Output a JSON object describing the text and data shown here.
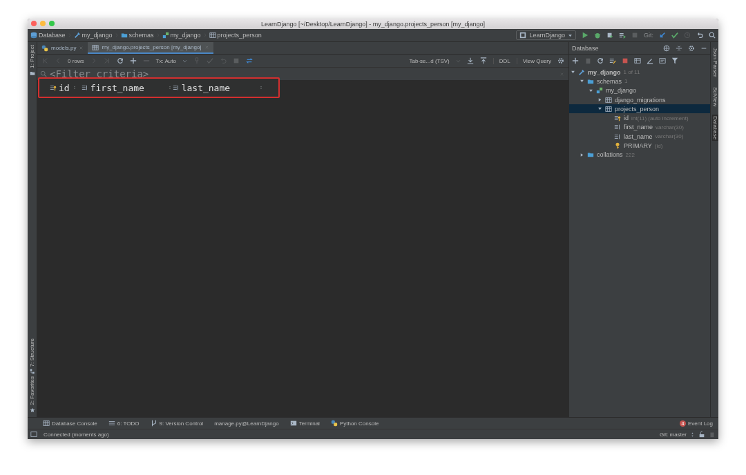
{
  "window": {
    "title": "LearnDjango [~/Desktop/LearnDjango] - my_django.projects_person [my_django]"
  },
  "breadcrumbs": [
    {
      "label": "Database",
      "kind": "database"
    },
    {
      "label": "my_django",
      "kind": "connection"
    },
    {
      "label": "schemas",
      "kind": "folder"
    },
    {
      "label": "my_django",
      "kind": "schema"
    },
    {
      "label": "projects_person",
      "kind": "table"
    }
  ],
  "run_config": {
    "label": "LearnDjango"
  },
  "git_toolbar": {
    "label": "Git:"
  },
  "left_strip": {
    "top": [
      {
        "label": "1: Project"
      }
    ],
    "bottom": [
      {
        "label": "7: Structure"
      },
      {
        "label": "2: Favorites"
      }
    ]
  },
  "editor_tabs": [
    {
      "label": "models.py",
      "kind": "python",
      "selected": false
    },
    {
      "label": "my_django.projects_person [my_django]",
      "kind": "table",
      "selected": true
    }
  ],
  "grid_toolbar": {
    "rows": "0 rows",
    "transaction": "Tx: Auto",
    "format": "Tab-se...d (TSV)",
    "buttons": [
      "DDL",
      "View Query"
    ]
  },
  "filter": {
    "placeholder": "<Filter criteria>"
  },
  "columns": [
    {
      "name": "id",
      "kind": "key"
    },
    {
      "name": "first_name",
      "kind": "column"
    },
    {
      "name": "last_name",
      "kind": "column"
    }
  ],
  "database_panel": {
    "title": "Database",
    "tree": [
      {
        "name": "my_django",
        "detail": "1 of 11",
        "kind": "connection",
        "expanded": true,
        "selected": false,
        "children": [
          {
            "name": "schemas",
            "detail": "1",
            "kind": "folder",
            "expanded": true,
            "selected": false,
            "children": [
              {
                "name": "my_django",
                "kind": "schema",
                "expanded": true,
                "selected": false,
                "children": [
                  {
                    "name": "django_migrations",
                    "kind": "table",
                    "expanded": false,
                    "selected": false
                  },
                  {
                    "name": "projects_person",
                    "kind": "table",
                    "expanded": true,
                    "selected": true,
                    "children": [
                      {
                        "name": "id",
                        "detail": "int(11) (auto increment)",
                        "kind": "key"
                      },
                      {
                        "name": "first_name",
                        "detail": "varchar(30)",
                        "kind": "column"
                      },
                      {
                        "name": "last_name",
                        "detail": "varchar(30)",
                        "kind": "column"
                      },
                      {
                        "name": "PRIMARY",
                        "detail": "(id)",
                        "kind": "index"
                      }
                    ]
                  }
                ]
              }
            ]
          },
          {
            "name": "collations",
            "detail": "222",
            "kind": "folder",
            "expanded": false,
            "selected": false
          }
        ]
      }
    ]
  },
  "right_strip": [
    {
      "label": "Json Parser",
      "selected": false
    },
    {
      "label": "SciView",
      "selected": false
    },
    {
      "label": "Database",
      "selected": true
    }
  ],
  "tool_windows": [
    {
      "label": "Database Console",
      "kind": "table"
    },
    {
      "label": "6: TODO",
      "kind": "list"
    },
    {
      "label": "9: Version Control",
      "kind": "vcs"
    },
    {
      "label": "manage.py@LearnDjango",
      "kind": "none"
    },
    {
      "label": "Terminal",
      "kind": "terminal"
    },
    {
      "label": "Python Console",
      "kind": "python"
    }
  ],
  "event_log": {
    "label": "Event Log",
    "count": "4"
  },
  "status_bar": {
    "message": "Connected (moments ago)",
    "branch": "Git: master"
  }
}
